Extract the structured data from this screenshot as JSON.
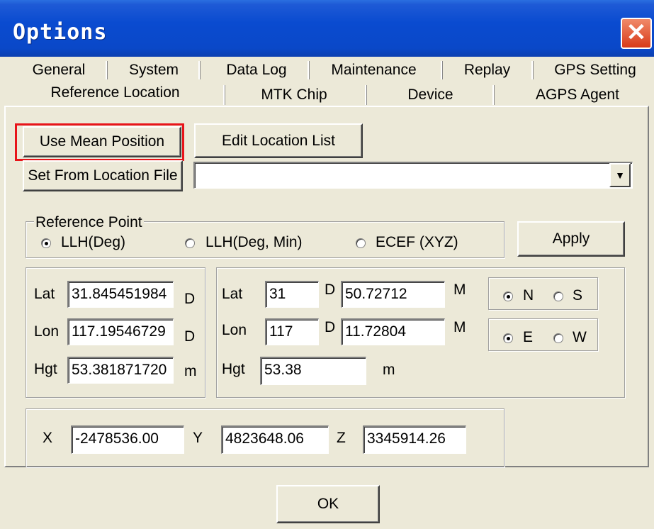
{
  "window": {
    "title": "Options",
    "close_glyph": "✕"
  },
  "tabs_row1": [
    "General",
    "System",
    "Data Log",
    "Maintenance",
    "Replay",
    "GPS Setting"
  ],
  "tabs_row2": [
    "Reference Location",
    "MTK Chip",
    "Device",
    "AGPS Agent"
  ],
  "active_tab": "Reference Location",
  "buttons": {
    "use_mean": "Use Mean Position",
    "edit_list": "Edit Location List",
    "set_from_file": "Set From Location File",
    "apply": "Apply",
    "ok": "OK"
  },
  "location_file": {
    "value": "",
    "dropdown_icon": "▼"
  },
  "reference_point": {
    "label": "Reference Point",
    "options": [
      "LLH(Deg)",
      "LLH(Deg, Min)",
      "ECEF (XYZ)"
    ],
    "selected": "LLH(Deg)"
  },
  "llh_deg": {
    "lat_label": "Lat",
    "lat_value": "31.845451984",
    "lat_unit": "D",
    "lon_label": "Lon",
    "lon_value": "117.19546729",
    "lon_unit": "D",
    "hgt_label": "Hgt",
    "hgt_value": "53.381871720",
    "hgt_unit": "m"
  },
  "llh_degmin": {
    "lat_label": "Lat",
    "lat_deg": "31",
    "lat_d": "D",
    "lat_min": "50.72712",
    "lat_m": "M",
    "lon_label": "Lon",
    "lon_deg": "117",
    "lon_d": "D",
    "lon_min": "11.72804",
    "lon_m": "M",
    "hgt_label": "Hgt",
    "hgt_value": "53.38",
    "hgt_unit": "m"
  },
  "hemisphere": {
    "ns": {
      "n": "N",
      "s": "S",
      "selected": "N"
    },
    "ew": {
      "e": "E",
      "w": "W",
      "selected": "E"
    }
  },
  "ecef": {
    "x_label": "X",
    "x_value": "-2478536.00",
    "y_label": "Y",
    "y_value": "4823648.06",
    "z_label": "Z",
    "z_value": "3345914.26"
  }
}
